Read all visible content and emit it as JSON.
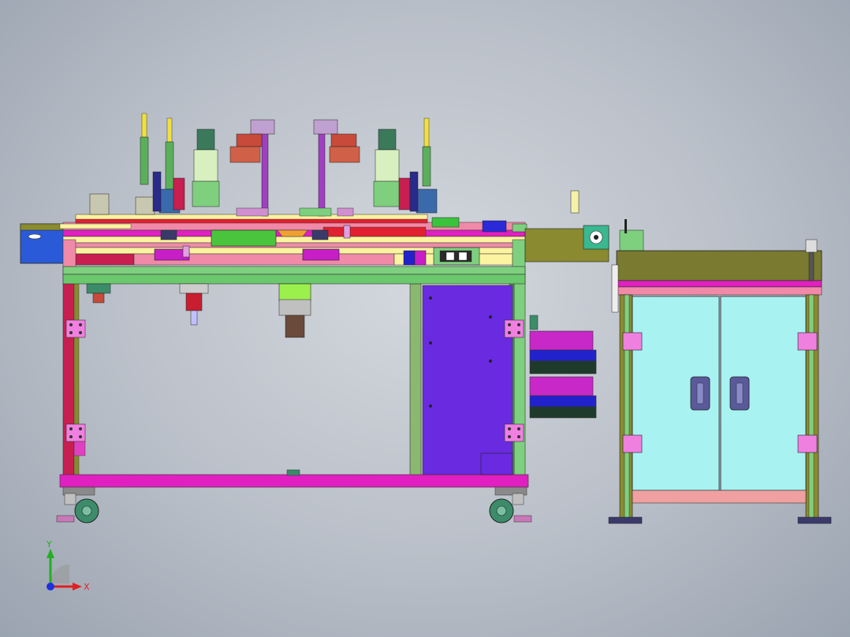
{
  "view": {
    "background_top": "#d4d8de",
    "background_bottom": "#9aa3b0"
  },
  "triad": {
    "x_label": "X",
    "y_label": "Y",
    "x_color": "#e02020",
    "y_color": "#20b020",
    "origin_color": "#2030e0"
  },
  "colors": {
    "frame_green": "#7ed07e",
    "frame_magenta": "#e020c0",
    "frame_red": "#c81e50",
    "panel_purple": "#6a2ae0",
    "cabinet_door": "#a8f2f2",
    "cabinet_top": "#7a7a30",
    "drawer_blue": "#2222cc",
    "drawer_magenta": "#c828c8",
    "caster_green": "#3c8c6a",
    "hinge_pink": "#f080e0",
    "plate_yellow": "#fbf3a0",
    "rail_pink": "#f08aa8",
    "handle_slate": "#5a5a9a",
    "lamp_red": "#c84a3a",
    "olive": "#8a8a30",
    "blue_box": "#2a5ad8"
  }
}
